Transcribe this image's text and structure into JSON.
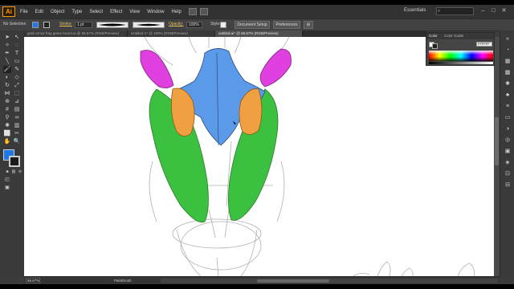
{
  "app": {
    "logo": "Ai",
    "menu": [
      "File",
      "Edit",
      "Object",
      "Type",
      "Select",
      "Effect",
      "View",
      "Window",
      "Help"
    ],
    "workspace": "Essentials",
    "search_placeholder": ""
  },
  "control_bar": {
    "selection_label": "No Selection",
    "stroke_label": "Stroke:",
    "stroke_weight": "1 pt",
    "opacity_label": "Opacity:",
    "opacity_value": "100%",
    "style_label": "Style:",
    "document_setup": "Document Setup",
    "preferences": "Preferences"
  },
  "tabs": [
    {
      "label": "grab arrow frag game board.ai @ 66.67% (RGB/Preview)",
      "active": false
    },
    {
      "label": "Untitled-1* @ 100% (RGB/Preview)",
      "active": false
    },
    {
      "label": "untitled.ai* @ 66.67% (RGB/Preview)",
      "active": true
    }
  ],
  "color_panel": {
    "tabs": [
      "Color",
      "Color Guide"
    ],
    "hex": "FFFFFF"
  },
  "status_bar": {
    "zoom": "66.67%",
    "tool": "Paintbrush"
  },
  "colors": {
    "fill": "#1e78e6",
    "magenta": "#e040e0",
    "blue": "#5a9ae8",
    "orange": "#f0a040",
    "green": "#40c040",
    "accent": "#ff9a00"
  },
  "icons": [
    "ai-logo",
    "bridge-icon",
    "arrange-icon",
    "search-icon",
    "minimize-icon",
    "maximize-icon",
    "close-icon"
  ]
}
